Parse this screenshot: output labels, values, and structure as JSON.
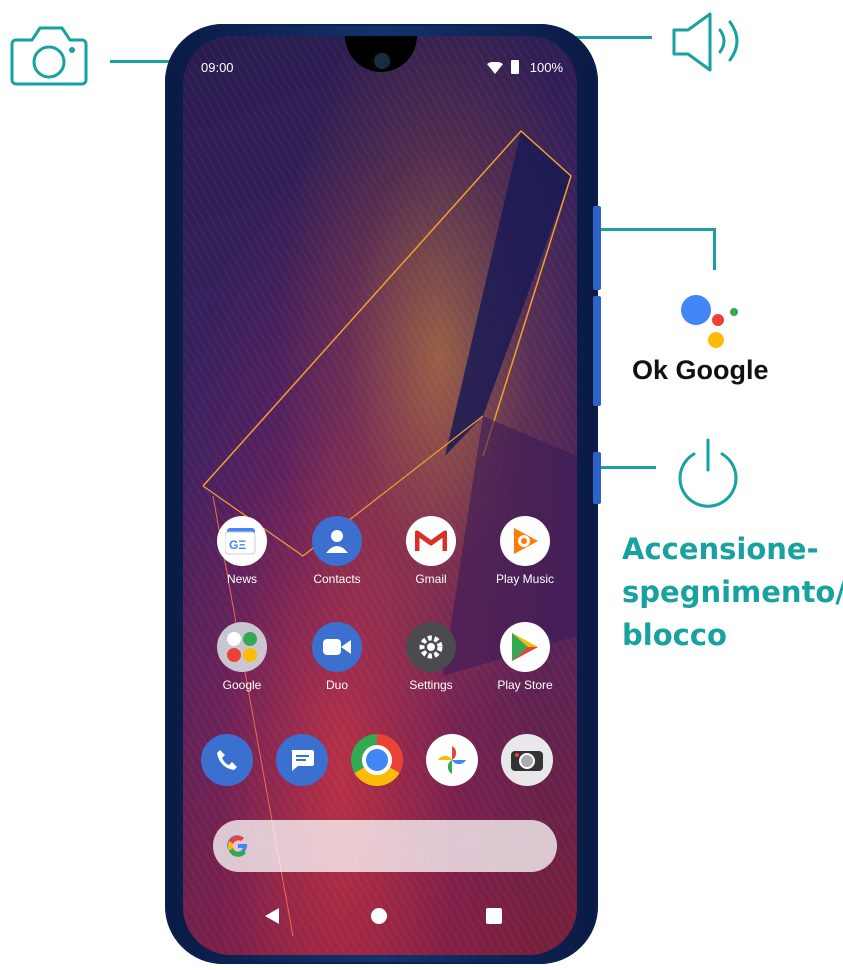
{
  "status_bar": {
    "time": "09:00",
    "battery": "100%",
    "wifi_icon": "wifi-icon",
    "battery_icon": "battery-icon"
  },
  "callouts": {
    "camera_icon": "camera-icon",
    "speaker_icon": "speaker-icon",
    "assistant_label": "Ok Google",
    "power_icon": "power-icon",
    "power_label_lines": [
      "Accensione-",
      "spegnimento/",
      "blocco"
    ]
  },
  "apps": [
    {
      "label": "News",
      "icon": "google-news-icon"
    },
    {
      "label": "Contacts",
      "icon": "contacts-icon"
    },
    {
      "label": "Gmail",
      "icon": "gmail-icon"
    },
    {
      "label": "Play Music",
      "icon": "play-music-icon"
    },
    {
      "label": "Google",
      "icon": "google-folder-icon"
    },
    {
      "label": "Duo",
      "icon": "duo-icon"
    },
    {
      "label": "Settings",
      "icon": "settings-icon"
    },
    {
      "label": "Play Store",
      "icon": "play-store-icon"
    }
  ],
  "dock": [
    "phone-icon",
    "messages-icon",
    "chrome-icon",
    "photos-icon",
    "camera-app-icon"
  ],
  "search_bar": {
    "logo": "google-g-icon"
  },
  "nav_bar": [
    "back-icon",
    "home-icon",
    "recents-icon"
  ],
  "colors": {
    "callout": "#17a2a0",
    "phone_body": "#12326e",
    "side_button": "#2b63c6"
  }
}
